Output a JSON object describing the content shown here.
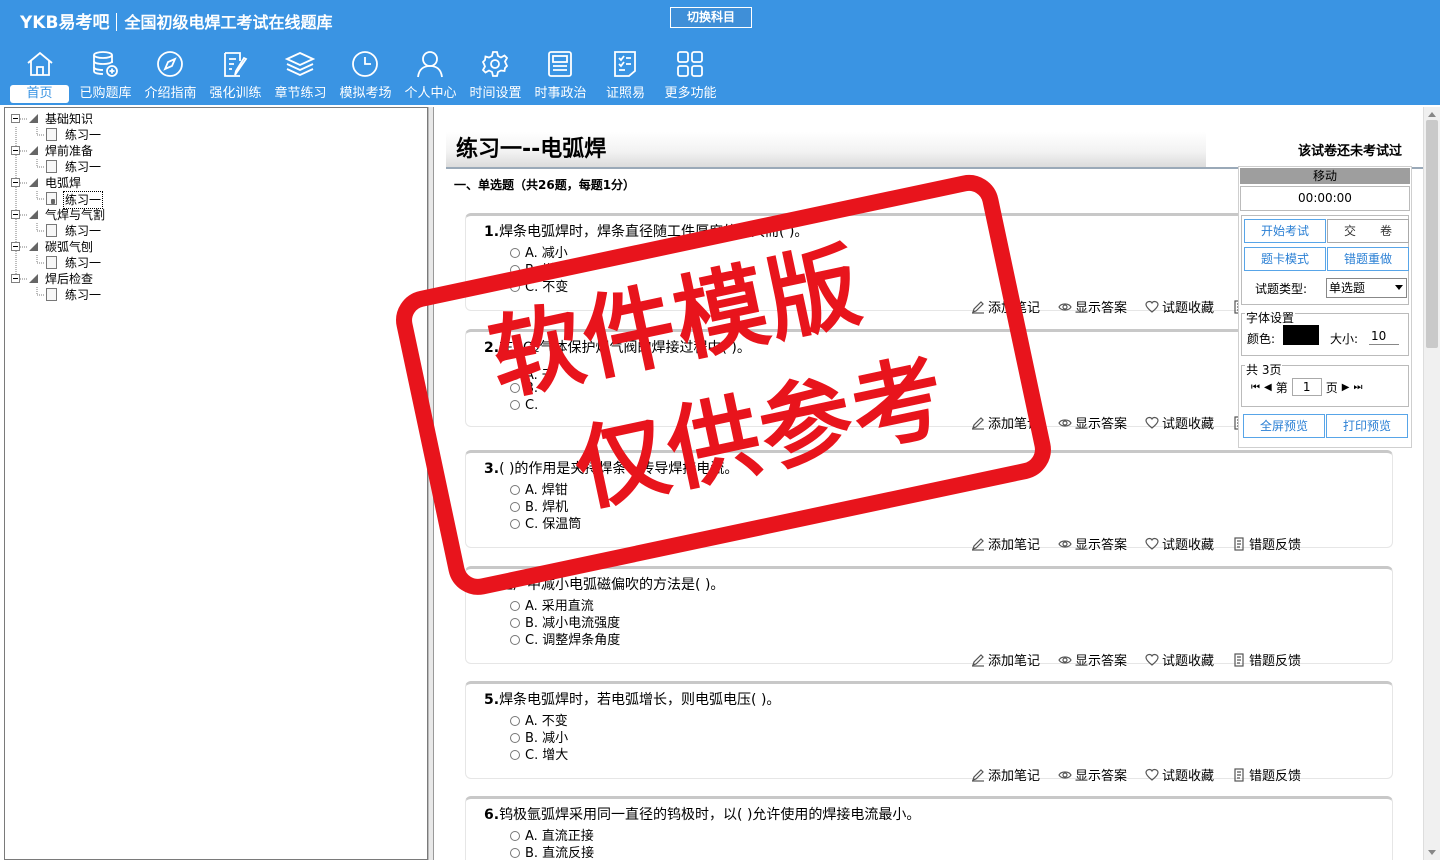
{
  "header": {
    "logo": "YKB易考吧",
    "app_title": "全国初级电焊工考试在线题库",
    "switch_subject": "切换科目"
  },
  "nav": [
    {
      "label": "首页",
      "icon": "home-icon"
    },
    {
      "label": "已购题库",
      "icon": "database-icon"
    },
    {
      "label": "介绍指南",
      "icon": "compass-icon"
    },
    {
      "label": "强化训练",
      "icon": "edit-icon"
    },
    {
      "label": "章节练习",
      "icon": "layers-icon"
    },
    {
      "label": "模拟考场",
      "icon": "clock-icon"
    },
    {
      "label": "个人中心",
      "icon": "user-icon"
    },
    {
      "label": "时间设置",
      "icon": "gear-icon"
    },
    {
      "label": "时事政治",
      "icon": "news-icon"
    },
    {
      "label": "证照易",
      "icon": "checklist-icon"
    },
    {
      "label": "更多功能",
      "icon": "grid-icon"
    }
  ],
  "tree": [
    {
      "label": "基础知识",
      "children": [
        "练习一"
      ]
    },
    {
      "label": "焊前准备",
      "children": [
        "练习一"
      ]
    },
    {
      "label": "电弧焊",
      "children": [
        "练习一"
      ],
      "selected": true
    },
    {
      "label": "气焊与气割",
      "children": [
        "练习一"
      ]
    },
    {
      "label": "碳弧气刨",
      "children": [
        "练习一"
      ]
    },
    {
      "label": "焊后检查",
      "children": [
        "练习一"
      ]
    }
  ],
  "paper": {
    "title": "练习一--电弧焊",
    "status": "该试卷还未考试过",
    "section": "一、单选题（共26题，每题1分）"
  },
  "actions": {
    "note": "添加笔记",
    "answer": "显示答案",
    "favorite": "试题收藏",
    "feedback": "错题反馈"
  },
  "questions": [
    {
      "num": "1.",
      "text": "焊条电弧焊时，焊条直径随工件厚度的增大而( )。",
      "options": [
        [
          "A.",
          "减小"
        ],
        [
          "B.",
          "增大"
        ],
        [
          "C.",
          "不变"
        ]
      ]
    },
    {
      "num": "2.",
      "text": "在CO₂气体保护焊气阀的焊接过程中( )。",
      "options": [
        [
          "A.",
          "干"
        ],
        [
          "B.",
          ""
        ],
        [
          "C.",
          ""
        ]
      ]
    },
    {
      "num": "3.",
      "text": "( )的作用是夹持焊条、传导焊接电流。",
      "options": [
        [
          "A.",
          "焊钳"
        ],
        [
          "B.",
          "焊机"
        ],
        [
          "C.",
          "保温筒"
        ]
      ]
    },
    {
      "num": "4.",
      "text": "生产中减小电弧磁偏吹的方法是( )。",
      "options": [
        [
          "A.",
          "采用直流"
        ],
        [
          "B.",
          "减小电流强度"
        ],
        [
          "C.",
          "调整焊条角度"
        ]
      ]
    },
    {
      "num": "5.",
      "text": "焊条电弧焊时，若电弧增长，则电弧电压( )。",
      "options": [
        [
          "A.",
          "不变"
        ],
        [
          "B.",
          "减小"
        ],
        [
          "C.",
          "增大"
        ]
      ]
    },
    {
      "num": "6.",
      "text": "钨极氩弧焊采用同一直径的钨极时，以( )允许使用的焊接电流最小。",
      "options": [
        [
          "A.",
          "直流正接"
        ],
        [
          "B.",
          "直流反接"
        ],
        [
          "C.",
          ""
        ]
      ]
    }
  ],
  "control": {
    "move": "移动",
    "timer": "00:00:00",
    "start": "开始考试",
    "submit": "交　　卷",
    "card_mode": "题卡模式",
    "redo_wrong": "错题重做",
    "type_label": "试题类型:",
    "type_value": "单选题",
    "font_settings": "字体设置",
    "color_label": "颜色:",
    "size_label": "大小:",
    "size_value": "10",
    "pages_total": "共 3页",
    "page_prefix": "第",
    "page_value": "1",
    "page_suffix": "页",
    "fullscreen": "全屏预览",
    "print": "打印预览"
  },
  "watermark": {
    "line1": "软件模版",
    "line2": "仅供参考"
  },
  "colors": {
    "header_bg": "#3a94e3",
    "accent": "#2a7fd4",
    "stamp": "#e8141c"
  }
}
